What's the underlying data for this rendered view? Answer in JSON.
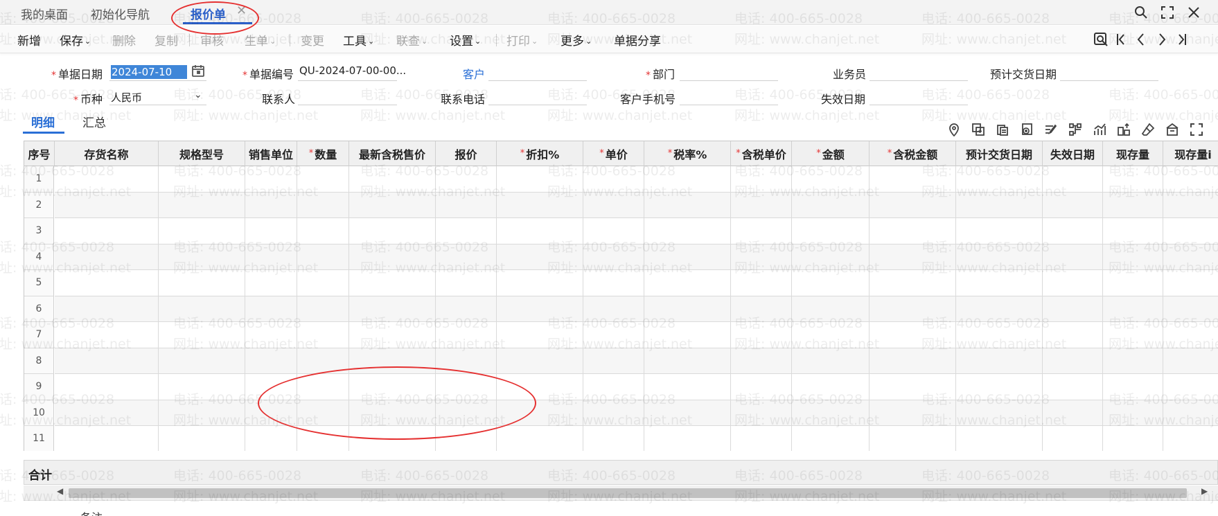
{
  "tabs": [
    {
      "label": "我的桌面",
      "active": false
    },
    {
      "label": "初始化导航",
      "active": false
    },
    {
      "label": "报价单",
      "active": true
    }
  ],
  "tab_close_glyph": "✕",
  "window_icons": [
    "search-icon",
    "maximize-icon",
    "close-icon"
  ],
  "toolbar": {
    "items": [
      {
        "label": "新增",
        "dropdown": false,
        "disabled": false
      },
      {
        "label": "保存",
        "dropdown": true,
        "disabled": false
      },
      {
        "label": "删除",
        "dropdown": false,
        "disabled": true
      },
      {
        "label": "复制",
        "dropdown": false,
        "disabled": true
      },
      {
        "label": "审核",
        "dropdown": false,
        "disabled": true
      },
      {
        "label": "生单",
        "dropdown": true,
        "disabled": true
      },
      {
        "label": "变更",
        "dropdown": false,
        "disabled": true
      },
      {
        "label": "工具",
        "dropdown": true,
        "disabled": false
      },
      {
        "label": "联查",
        "dropdown": true,
        "disabled": true
      },
      {
        "label": "设置",
        "dropdown": true,
        "disabled": false
      },
      {
        "label": "打印",
        "dropdown": true,
        "disabled": true
      },
      {
        "label": "更多",
        "dropdown": true,
        "disabled": false
      },
      {
        "label": "单据分享",
        "dropdown": false,
        "disabled": false
      }
    ],
    "nav_icons": [
      "preview-icon",
      "first-record-icon",
      "prev-record-icon",
      "next-record-icon",
      "last-record-icon"
    ]
  },
  "form": {
    "doc_date_label": "单据日期",
    "doc_date_value": "2024-07-10",
    "doc_no_label": "单据编号",
    "doc_no_value": "QU-2024-07-00-00...",
    "customer_label": "客户",
    "dept_label": "部门",
    "salesman_label": "业务员",
    "delivery_date_label": "预计交货日期",
    "currency_label": "币种",
    "currency_value": "人民币",
    "contact_label": "联系人",
    "phone_label": "联系电话",
    "mobile_label": "客户手机号",
    "expire_label": "失效日期"
  },
  "subtabs": [
    {
      "label": "明细",
      "active": true
    },
    {
      "label": "汇总",
      "active": false
    }
  ],
  "grid_tool_icons": [
    "locate-icon",
    "copy-row-icon",
    "paste-icon",
    "insert-icon",
    "edit-icon",
    "split-icon",
    "chart-icon",
    "batch-icon",
    "eraser-icon",
    "bank-icon",
    "fullscreen-icon"
  ],
  "grid": {
    "columns": [
      {
        "label": "序号",
        "required": false
      },
      {
        "label": "存货名称",
        "required": false
      },
      {
        "label": "规格型号",
        "required": false
      },
      {
        "label": "销售单位",
        "required": false
      },
      {
        "label": "数量",
        "required": true
      },
      {
        "label": "最新含税售价",
        "required": false
      },
      {
        "label": "报价",
        "required": false
      },
      {
        "label": "折扣%",
        "required": true
      },
      {
        "label": "单价",
        "required": true
      },
      {
        "label": "税率%",
        "required": true
      },
      {
        "label": "含税单价",
        "required": true
      },
      {
        "label": "金额",
        "required": true
      },
      {
        "label": "含税金额",
        "required": true
      },
      {
        "label": "预计交货日期",
        "required": false
      },
      {
        "label": "失效日期",
        "required": false
      },
      {
        "label": "现存量",
        "required": false
      },
      {
        "label": "现存量i",
        "required": false
      }
    ],
    "rows": [
      "1",
      "2",
      "3",
      "4",
      "5",
      "6",
      "7",
      "8",
      "9",
      "10",
      "11"
    ]
  },
  "total_label": "合计",
  "memo_label": "备注",
  "watermark": {
    "phone": "电话: 400-665-0028",
    "url": "网址: www.chanjet.net"
  },
  "colors": {
    "accent": "#2a5fc9",
    "required": "#e43434",
    "annotation": "#e53030",
    "selection": "#3f86d8"
  }
}
